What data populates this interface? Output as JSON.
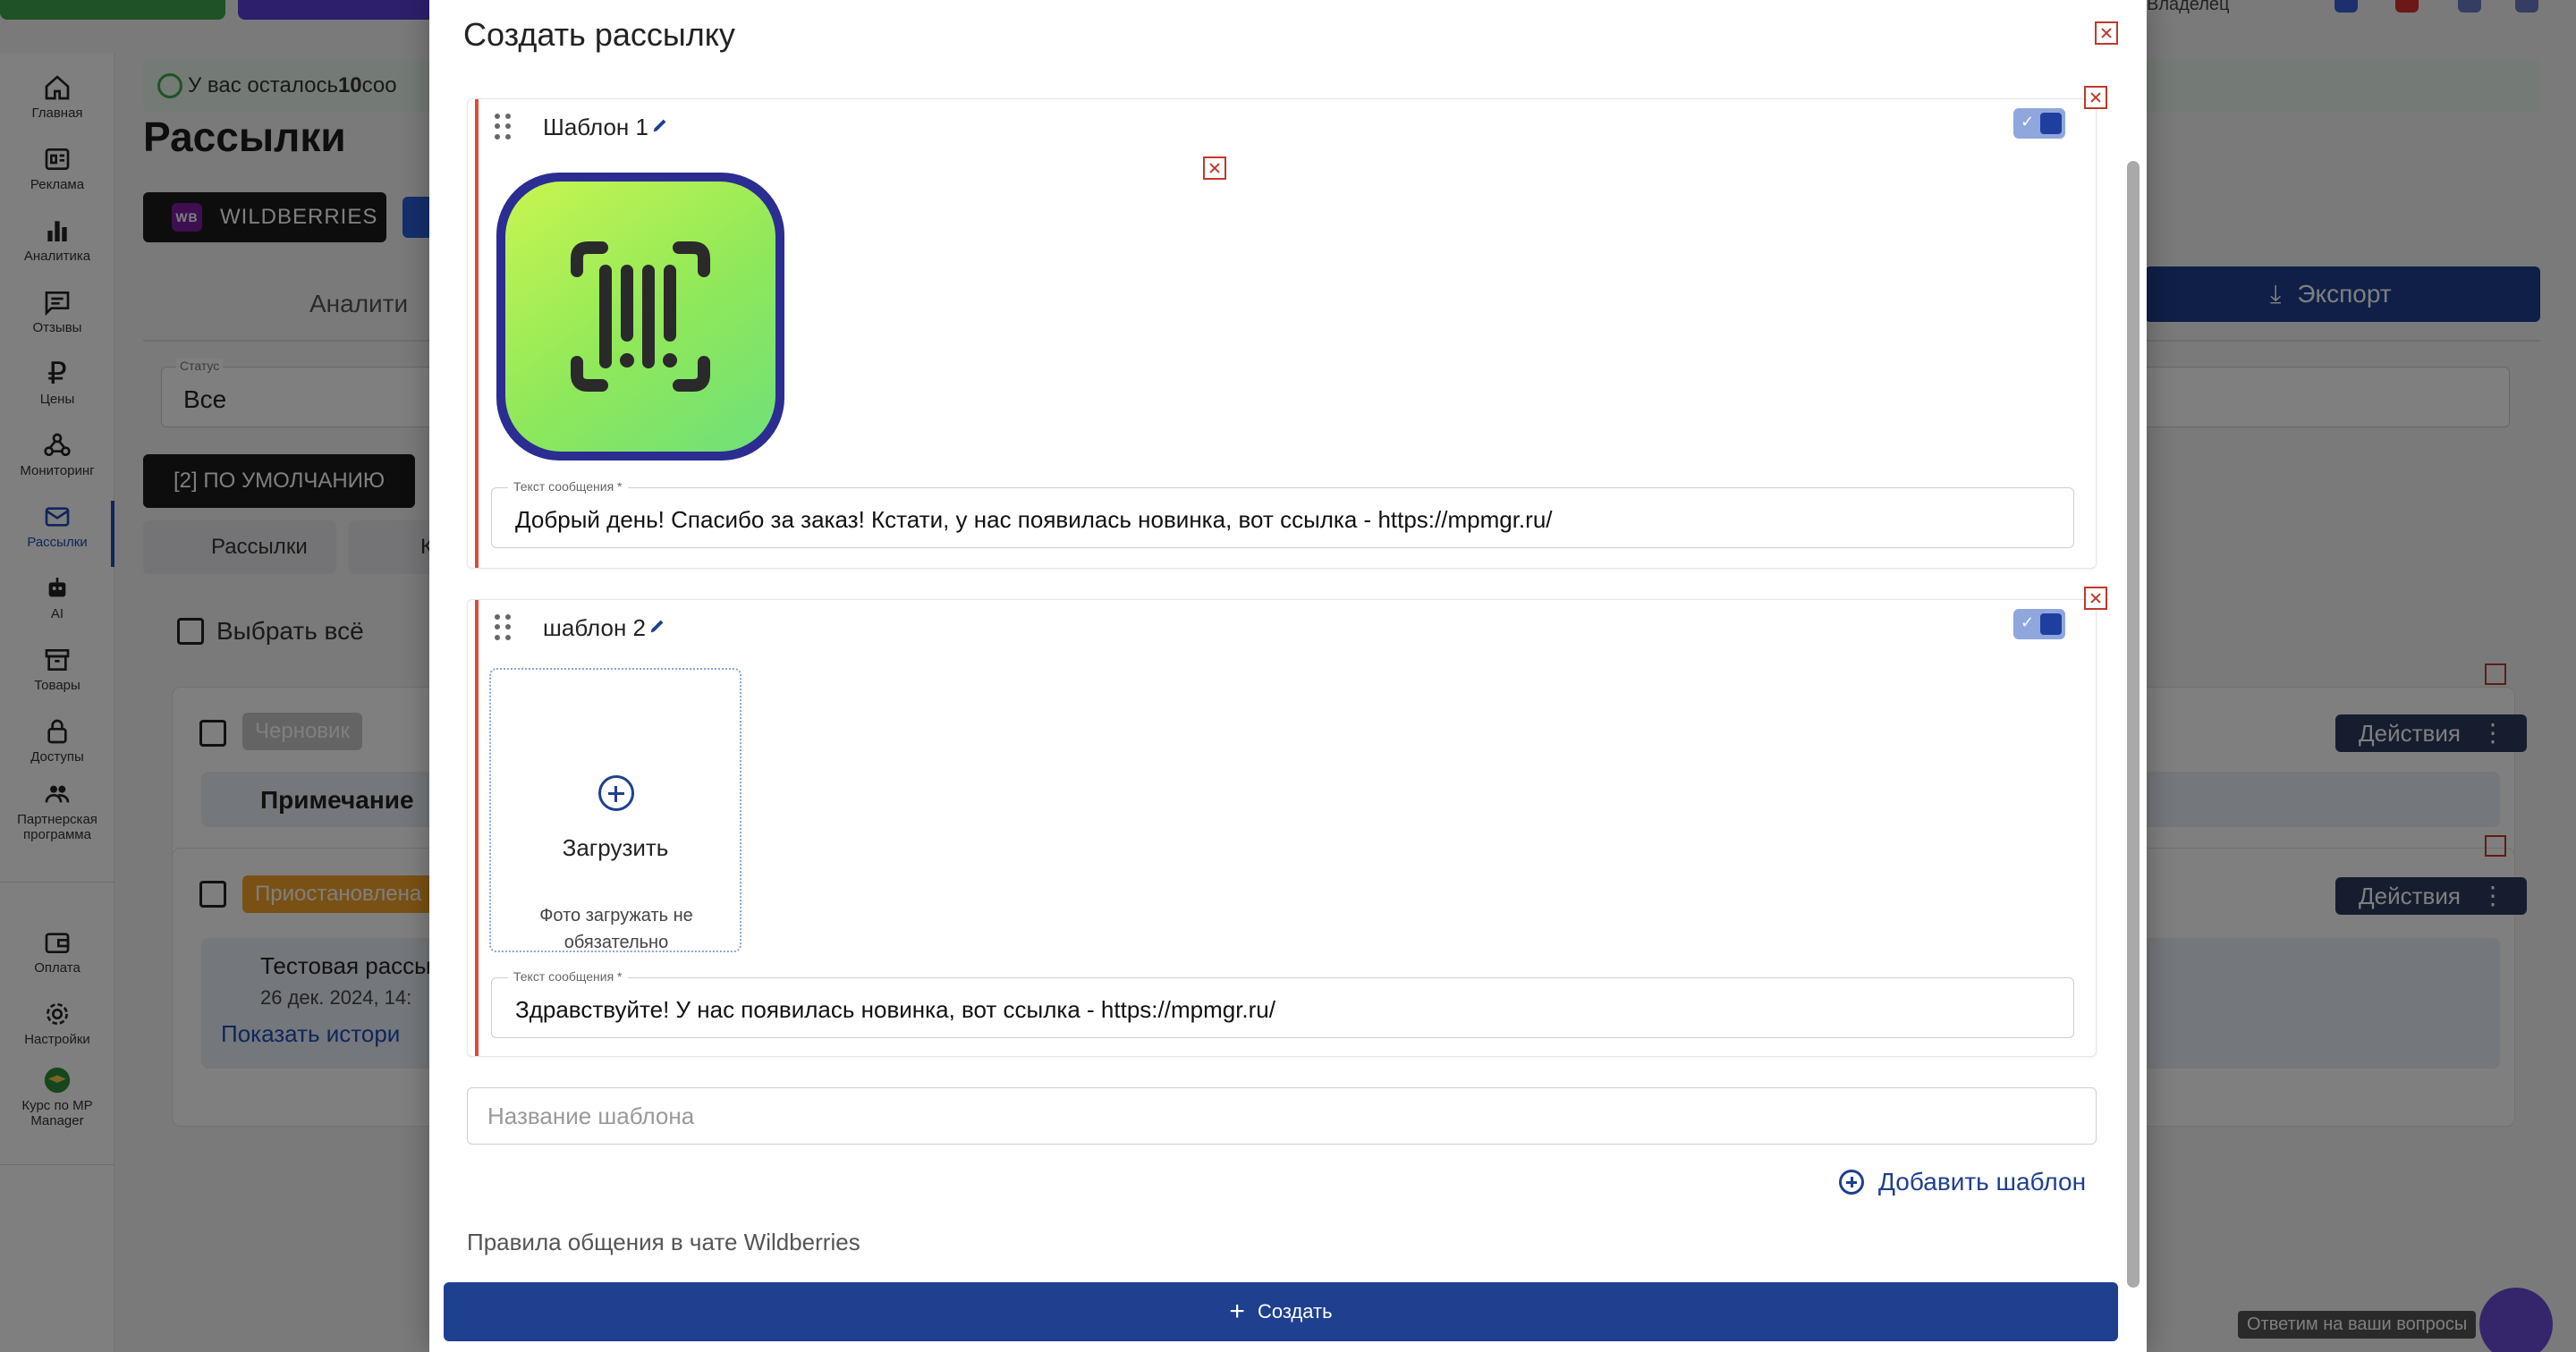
{
  "background": {
    "top_owner": "Владелец",
    "sidebar": [
      {
        "label": "Главная",
        "icon": "home-icon"
      },
      {
        "label": "Реклама",
        "icon": "ads-icon"
      },
      {
        "label": "Аналитика",
        "icon": "chart-icon"
      },
      {
        "label": "Отзывы",
        "icon": "reviews-icon"
      },
      {
        "label": "Цены",
        "icon": "ruble-icon"
      },
      {
        "label": "Мониторинг",
        "icon": "monitoring-icon"
      },
      {
        "label": "Рассылки",
        "icon": "mail-icon",
        "active": true
      },
      {
        "label": "AI",
        "icon": "robot-icon"
      },
      {
        "label": "Товары",
        "icon": "box-icon"
      },
      {
        "label": "Доступы",
        "icon": "lock-icon"
      },
      {
        "label": "Партнерская программа",
        "icon": "partners-icon"
      },
      {
        "label": "Оплата",
        "icon": "wallet-icon"
      },
      {
        "label": "Настройки",
        "icon": "gear-icon"
      },
      {
        "label": "Курс по MP Manager",
        "icon": "course-icon"
      }
    ],
    "alert_prefix": "У вас осталось ",
    "alert_count": "10",
    "alert_suffix": " соо",
    "page_title": "Рассылки",
    "marketplace_tab": "WILDBERRIES",
    "marketplace_badge": "WB",
    "section_tab": "Аналити",
    "export_label": "Экспорт",
    "status_label": "Статус",
    "status_value": "Все",
    "default_chip": "[2] ПО УМОЛЧАНИЮ",
    "sub_tab_1": "Рассылки",
    "sub_tab_2": "К",
    "select_all": "Выбрать всё",
    "card1_status": "Черновик",
    "card1_note": "Примечание",
    "card2_status": "Приостановлена",
    "card2_title": "Тестовая рассы",
    "card2_date": "26 дек. 2024, 14:",
    "card2_link": "Показать истори",
    "actions_label": "Действия",
    "chat_hint": "Ответим на ваши вопросы"
  },
  "modal": {
    "title": "Создать рассылку",
    "templates": [
      {
        "name": "Шаблон 1",
        "enabled": true,
        "has_image": true,
        "message_label": "Текст сообщения *",
        "message": "Добрый день! Спасибо за заказ! Кстати, у нас появилась новинка, вот ссылка - https://mpmgr.ru/"
      },
      {
        "name": "шаблон 2",
        "enabled": true,
        "has_image": false,
        "upload_label": "Загрузить",
        "upload_hint": "Фото загружать не обязательно",
        "message_label": "Текст сообщения *",
        "message": "Здравствуйте! У нас появилась новинка, вот ссылка - https://mpmgr.ru/"
      }
    ],
    "name_placeholder": "Название шаблона",
    "add_template": "Добавить шаблон",
    "rules": "Правила общения в чате Wildberries",
    "create_label": "Создать",
    "accent_color": "#1f3f8f",
    "error_color": "#c0392b"
  }
}
